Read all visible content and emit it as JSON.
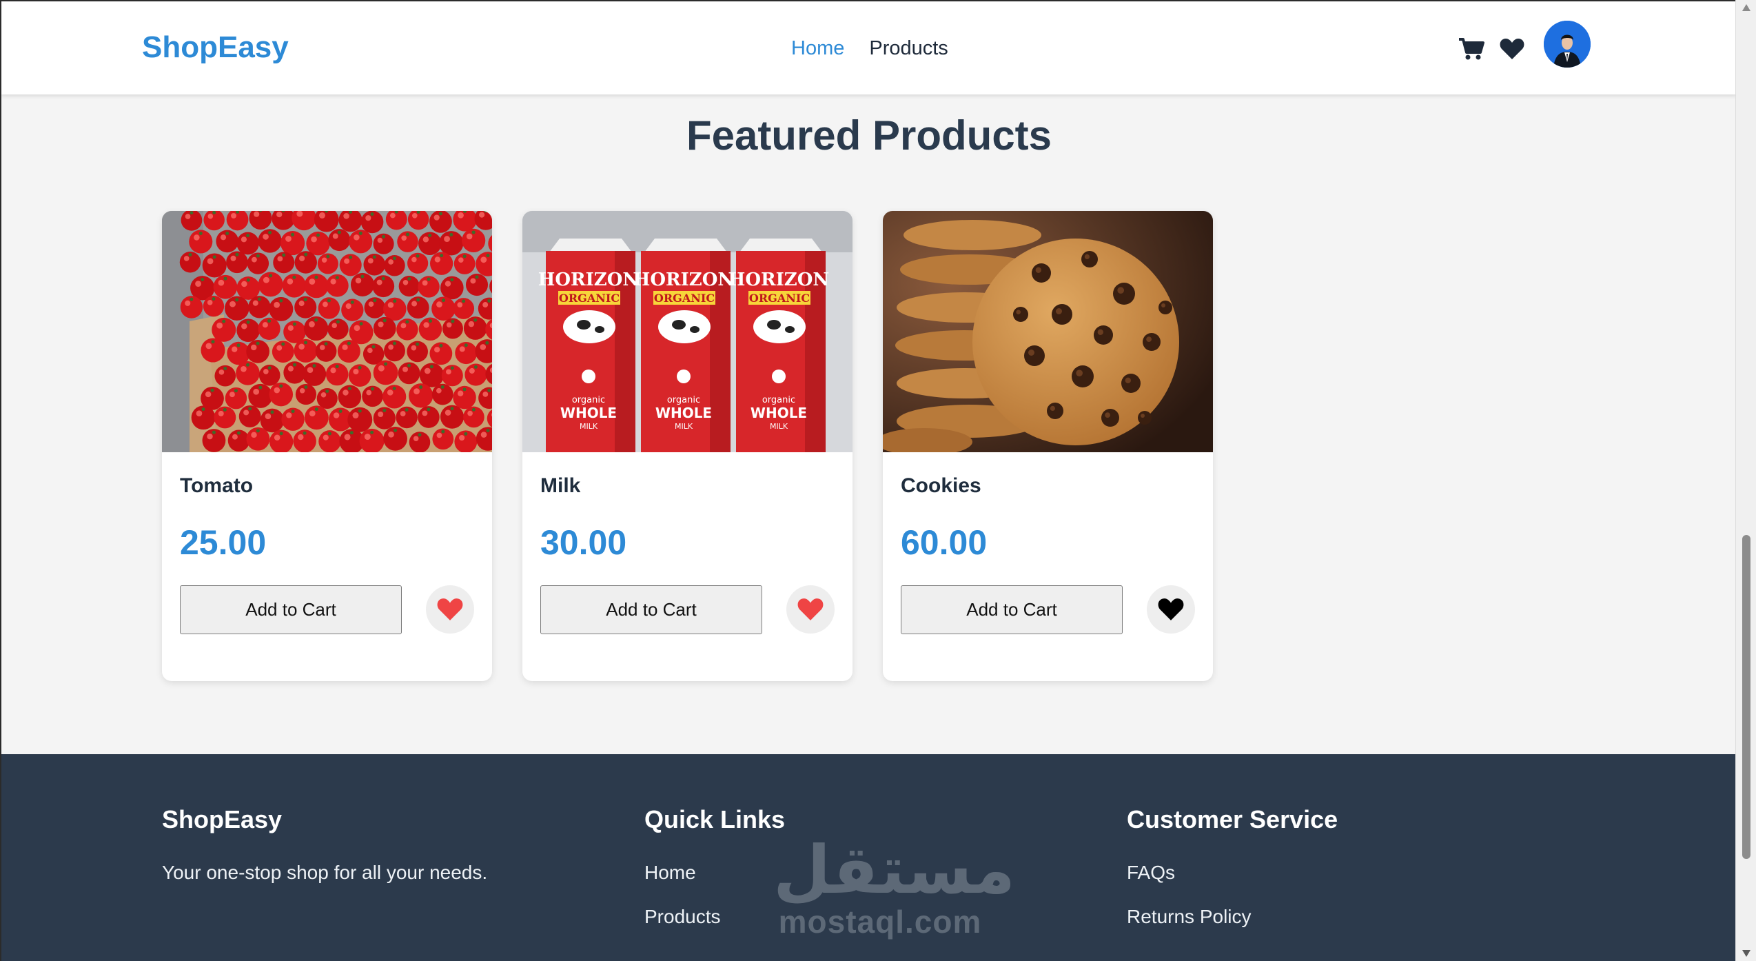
{
  "header": {
    "brand": "ShopEasy",
    "nav": [
      {
        "label": "Home",
        "active": true
      },
      {
        "label": "Products",
        "active": false
      }
    ],
    "icons": [
      "cart-icon",
      "heart-icon",
      "avatar"
    ]
  },
  "main": {
    "title": "Featured Products",
    "products": [
      {
        "name": "Tomato",
        "price": "25.00",
        "button": "Add to Cart",
        "favorite": true,
        "image": "tomatoes"
      },
      {
        "name": "Milk",
        "price": "30.00",
        "button": "Add to Cart",
        "favorite": true,
        "image": "milk-cartons"
      },
      {
        "name": "Cookies",
        "price": "60.00",
        "button": "Add to Cart",
        "favorite": false,
        "image": "cookies"
      }
    ]
  },
  "milk_label": {
    "brand": "HORIZON",
    "sub": "ORGANIC",
    "type": "WHOLE",
    "kind": "organic",
    "unit": "MILK"
  },
  "footer": {
    "brand": "ShopEasy",
    "tagline": "Your one-stop shop for all your needs.",
    "quick_links": {
      "title": "Quick Links",
      "links": [
        "Home",
        "Products"
      ]
    },
    "customer_service": {
      "title": "Customer Service",
      "links": [
        "FAQs",
        "Returns Policy"
      ]
    }
  },
  "watermark": {
    "arabic": "مستقل",
    "latin": "mostaql.com"
  },
  "colors": {
    "accent": "#2d8ad6",
    "heading": "#2a3a4d",
    "footer_bg": "#2c3a4c",
    "heart_active": "#ef4444",
    "heart_inactive": "#000000"
  }
}
